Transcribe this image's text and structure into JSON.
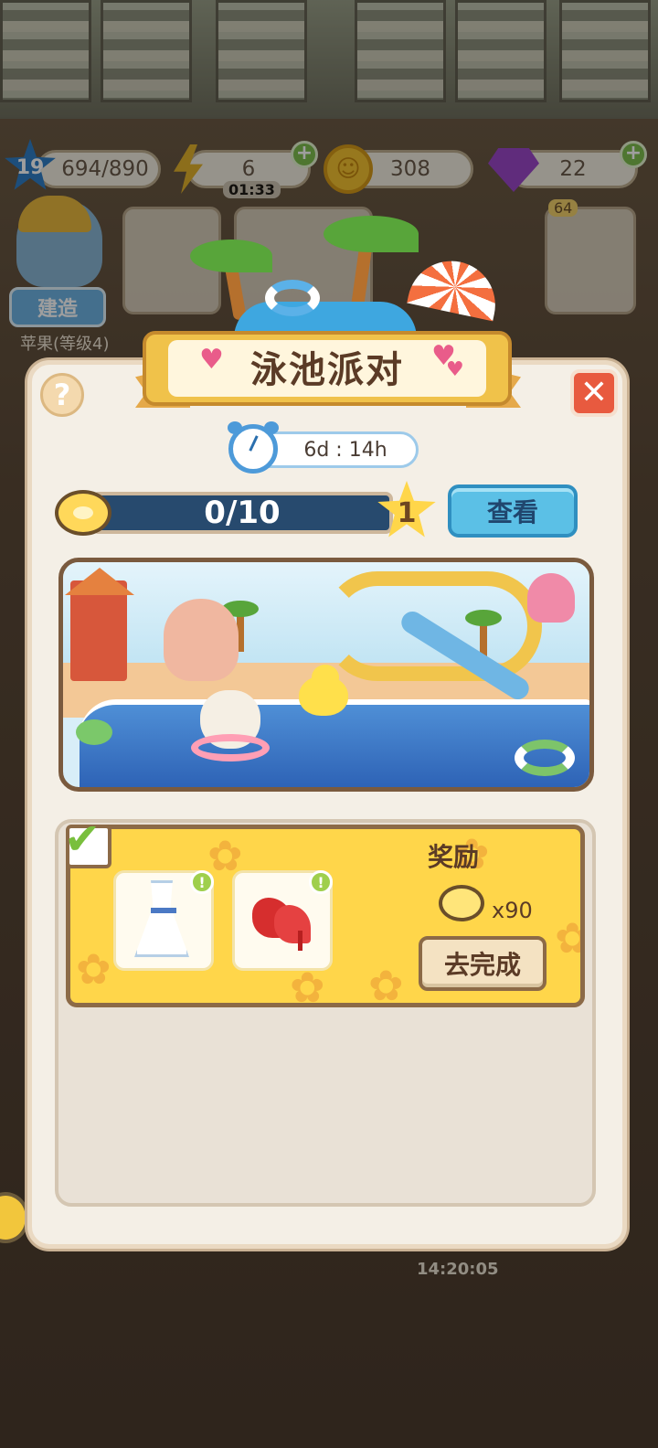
{
  "hud": {
    "level": "19",
    "xp": "694/890",
    "energy": "6",
    "energy_timer": "01:33",
    "coins": "308",
    "gems": "22",
    "plus": "+"
  },
  "background": {
    "build_label": "建造",
    "item_label": "苹果(等级4)",
    "shop_price": "64",
    "bottom_timer": "14:20:05"
  },
  "event": {
    "title": "泳池派对",
    "timer": "6d : 14h",
    "progress_text": "0/10",
    "progress_value": 0,
    "progress_max": 10,
    "tier": "1",
    "view_label": "查看",
    "help_label": "?",
    "close_label": "✕"
  },
  "task": {
    "completed_check": "✔",
    "items": [
      {
        "icon": "white-dress-icon",
        "info": "!"
      },
      {
        "icon": "red-heels-icon",
        "info": "!"
      }
    ],
    "reward_label": "奖励",
    "reward_qty": "x90",
    "go_label": "去完成"
  },
  "colors": {
    "banner": "#f0c24a",
    "view_button": "#5bc0e6",
    "task_card": "#ffd64a",
    "close_button": "#e85a3f"
  }
}
